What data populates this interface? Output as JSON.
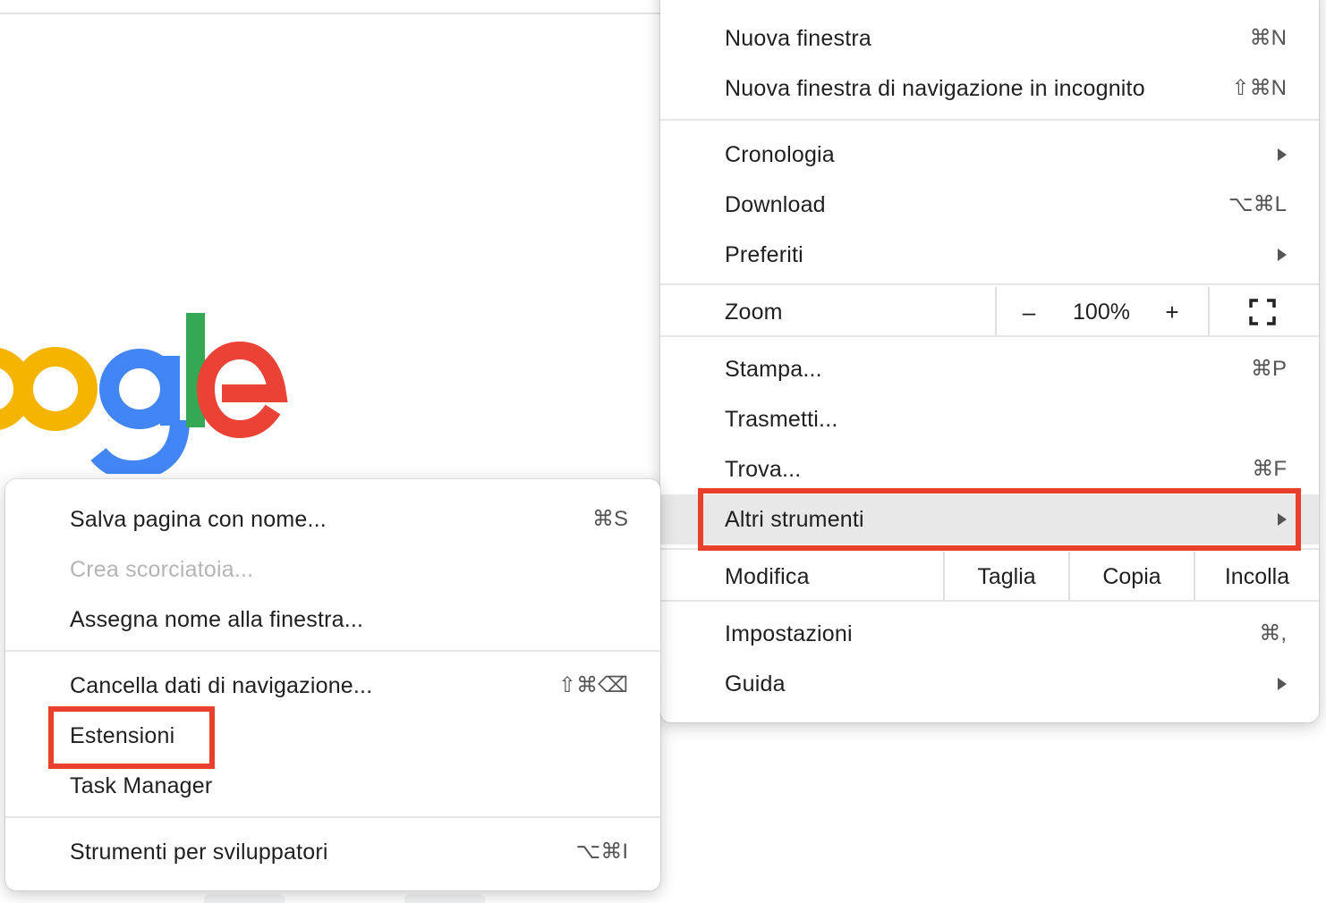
{
  "colors": {
    "annotation": "#e8402c",
    "google_yellow": "#f4b400",
    "google_blue": "#4285f4",
    "google_green": "#34a853",
    "google_red": "#ea4335"
  },
  "main_menu": {
    "new_window": {
      "label": "Nuova finestra",
      "shortcut": "⌘N"
    },
    "new_incognito": {
      "label": "Nuova finestra di navigazione in incognito",
      "shortcut": "⇧⌘N"
    },
    "history": {
      "label": "Cronologia",
      "icon": "chevron-right-icon"
    },
    "downloads": {
      "label": "Download",
      "shortcut": "⌥⌘L"
    },
    "bookmarks": {
      "label": "Preferiti",
      "icon": "chevron-right-icon"
    },
    "zoom": {
      "label": "Zoom",
      "minus": "–",
      "value": "100%",
      "plus": "+",
      "fullscreen_icon": "fullscreen-icon"
    },
    "print": {
      "label": "Stampa...",
      "shortcut": "⌘P"
    },
    "cast": {
      "label": "Trasmetti..."
    },
    "find": {
      "label": "Trova...",
      "shortcut": "⌘F"
    },
    "more_tools": {
      "label": "Altri strumenti",
      "icon": "chevron-right-icon"
    },
    "edit": {
      "label": "Modifica",
      "cut": "Taglia",
      "copy": "Copia",
      "paste": "Incolla"
    },
    "settings": {
      "label": "Impostazioni",
      "shortcut": "⌘,"
    },
    "help": {
      "label": "Guida",
      "icon": "chevron-right-icon"
    }
  },
  "sub_menu": {
    "save_page": {
      "label": "Salva pagina con nome...",
      "shortcut": "⌘S"
    },
    "create_shortcut": {
      "label": "Crea scorciatoia..."
    },
    "name_window": {
      "label": "Assegna nome alla finestra..."
    },
    "clear_data": {
      "label": "Cancella dati di navigazione...",
      "shortcut": "⇧⌘⌫"
    },
    "extensions": {
      "label": "Estensioni"
    },
    "task_manager": {
      "label": "Task Manager"
    },
    "dev_tools": {
      "label": "Strumenti per sviluppatori",
      "shortcut": "⌥⌘I"
    }
  }
}
